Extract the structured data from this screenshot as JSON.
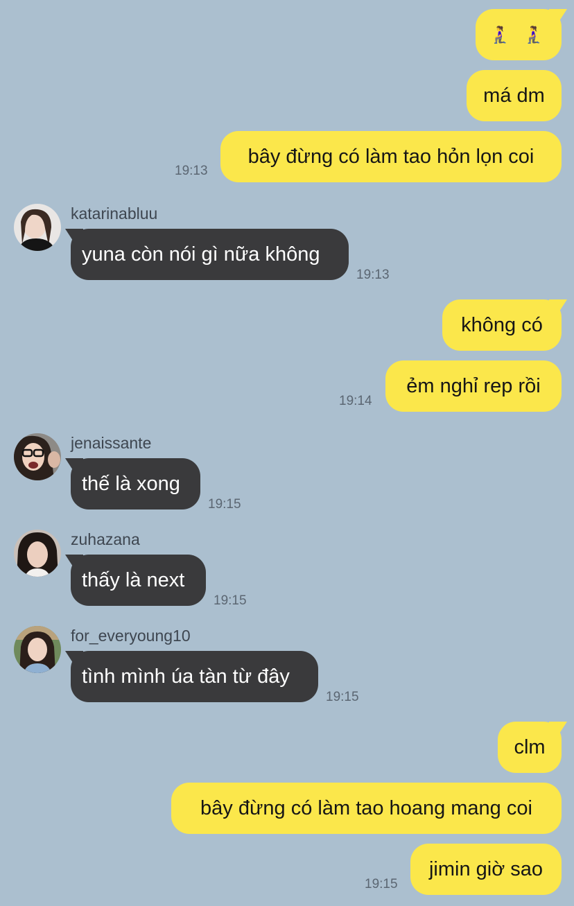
{
  "colors": {
    "background": "#abbfcf",
    "outgoing_bubble": "#fbe74b",
    "incoming_bubble": "#3a3a3c"
  },
  "messages": [
    {
      "text": "🧎‍♀️ 🧎‍♀️",
      "direction": "out"
    },
    {
      "text": "má dm",
      "direction": "out"
    },
    {
      "text": "bây đừng có làm tao hỏn lọn coi",
      "direction": "out",
      "time": "19:13"
    },
    {
      "sender": "katarinabluu",
      "avatar_icon": "profile-photo",
      "text": "yuna còn nói gì nữa không",
      "direction": "in",
      "time": "19:13"
    },
    {
      "text": "không có",
      "direction": "out"
    },
    {
      "text": "ẻm nghỉ rep rồi",
      "direction": "out",
      "time": "19:14"
    },
    {
      "sender": "jenaissante",
      "avatar_icon": "profile-photo",
      "text": "thế là xong",
      "direction": "in",
      "time": "19:15"
    },
    {
      "sender": "zuhazana",
      "avatar_icon": "profile-photo",
      "text": "thấy là next",
      "direction": "in",
      "time": "19:15"
    },
    {
      "sender": "for_everyoung10",
      "avatar_icon": "profile-photo",
      "text": "tình mình úa tàn từ đây",
      "direction": "in",
      "time": "19:15"
    },
    {
      "text": "clm",
      "direction": "out"
    },
    {
      "text": "bây đừng có làm tao hoang mang coi",
      "direction": "out"
    },
    {
      "text": "jimin giờ sao",
      "direction": "out",
      "time": "19:15"
    }
  ]
}
